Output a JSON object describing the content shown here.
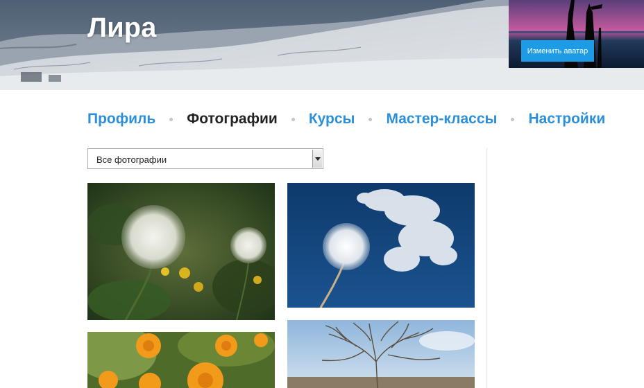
{
  "profile": {
    "name": "Лира",
    "change_avatar_label": "Изменить аватар"
  },
  "nav": {
    "items": [
      {
        "label": "Профиль",
        "active": false
      },
      {
        "label": "Фотографии",
        "active": true
      },
      {
        "label": "Курсы",
        "active": false
      },
      {
        "label": "Мастер-классы",
        "active": false
      },
      {
        "label": "Настройки",
        "active": false
      }
    ]
  },
  "filter": {
    "selected": "Все фотографии"
  },
  "colors": {
    "link": "#2b8fdc",
    "active_link": "#222222",
    "button": "#1e9be5"
  }
}
